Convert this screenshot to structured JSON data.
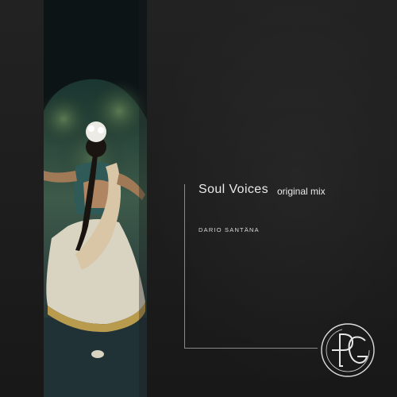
{
  "cover": {
    "title": "Soul Voices",
    "subtitle": "original mix",
    "artist": "DARIO SANTÄNA"
  },
  "icons": {
    "logo": "ds-monogram-circle-icon",
    "photo": "dancer-photo"
  },
  "colors": {
    "background": "#1d1d1d",
    "text": "#e9e9e9",
    "rule": "#8a8a8a"
  }
}
